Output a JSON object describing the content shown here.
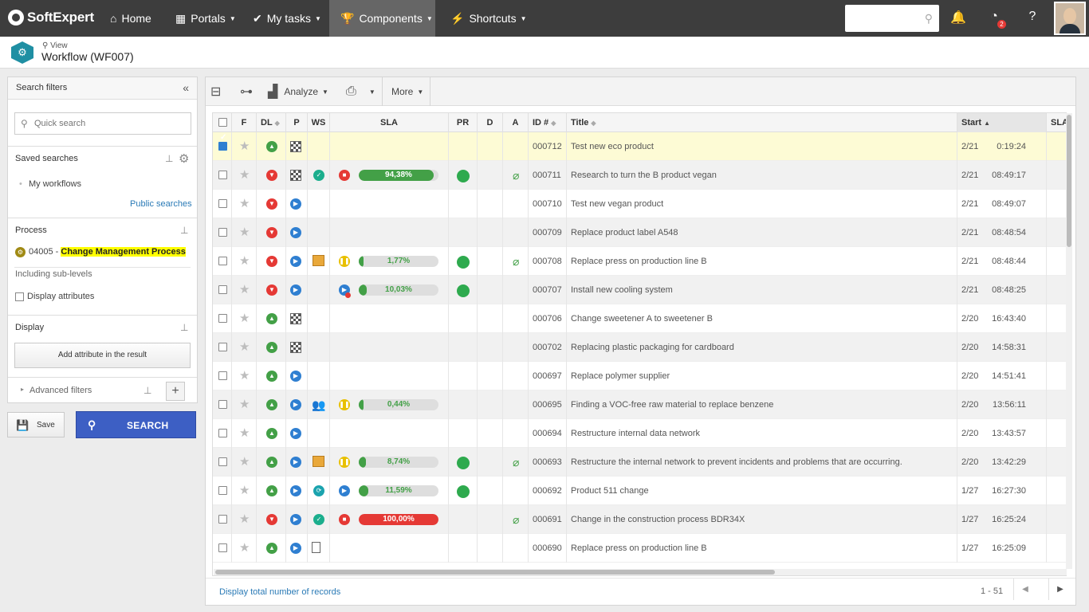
{
  "topnav": {
    "brand": "SoftExpert",
    "items": [
      {
        "label": "Home",
        "icon": "home-icon"
      },
      {
        "label": "Portals",
        "icon": "grid-icon"
      },
      {
        "label": "My tasks",
        "icon": "check-icon"
      },
      {
        "label": "Components",
        "icon": "trophy-icon"
      },
      {
        "label": "Shortcuts",
        "icon": "bolt-icon"
      }
    ],
    "search_placeholder": "",
    "notification_badge": "2"
  },
  "header": {
    "view_label": "View",
    "title": "Workflow (WF007)"
  },
  "leftpanel": {
    "title": "Search filters",
    "quick_search_placeholder": "Quick search",
    "saved_searches_label": "Saved searches",
    "my_workflows": "My workflows",
    "public_searches": "Public searches",
    "process_label": "Process",
    "process_code": "04005 - ",
    "process_name": "Change Management Process",
    "including_sublevels": "Including sub-levels",
    "display_attributes": "Display attributes",
    "display_label": "Display",
    "add_attribute": "Add attribute in the result",
    "advanced_filters": "Advanced filters",
    "save_label": "Save",
    "search_label": "SEARCH"
  },
  "toolbar": {
    "analyze_label": "Analyze",
    "more_label": "More"
  },
  "grid": {
    "columns": [
      "F",
      "DL",
      "P",
      "WS",
      "SLA",
      "PR",
      "D",
      "A",
      "ID #",
      "Title",
      "Start",
      "SLA"
    ],
    "rows": [
      {
        "id": "000712",
        "title": "Test new eco product",
        "date": "2/21",
        "time": "0:19:24",
        "dl": "up",
        "p": "flag",
        "ws": "",
        "sla_icon": "",
        "sla_pct": "",
        "sla_val": 0,
        "pr": false,
        "a": false,
        "checked": true
      },
      {
        "id": "000711",
        "title": "Research to turn the B product vegan",
        "date": "2/21",
        "time": "08:49:17",
        "dl": "down",
        "p": "flag",
        "ws": "ok",
        "sla_icon": "stop",
        "sla_pct": "94,38%",
        "sla_val": 94.38,
        "pr": true,
        "a": true,
        "checked": false
      },
      {
        "id": "000710",
        "title": "Test new vegan product",
        "date": "2/21",
        "time": "08:49:07",
        "dl": "down",
        "p": "play",
        "ws": "",
        "sla_icon": "",
        "sla_pct": "",
        "sla_val": 0,
        "pr": false,
        "a": false,
        "checked": false
      },
      {
        "id": "000709",
        "title": "Replace product label A548",
        "date": "2/21",
        "time": "08:48:54",
        "dl": "down",
        "p": "play",
        "ws": "",
        "sla_icon": "",
        "sla_pct": "",
        "sla_val": 0,
        "pr": false,
        "a": false,
        "checked": false
      },
      {
        "id": "000708",
        "title": "Replace press on production line B",
        "date": "2/21",
        "time": "08:48:44",
        "dl": "down",
        "p": "play",
        "ws": "box",
        "sla_icon": "pause",
        "sla_pct": "1,77%",
        "sla_val": 1.77,
        "pr": true,
        "a": true,
        "checked": false
      },
      {
        "id": "000707",
        "title": "Install new cooling system",
        "date": "2/21",
        "time": "08:48:25",
        "dl": "down",
        "p": "play",
        "ws": "",
        "sla_icon": "play-badge",
        "sla_pct": "10,03%",
        "sla_val": 10.03,
        "pr": true,
        "a": false,
        "checked": false
      },
      {
        "id": "000706",
        "title": "Change sweetener A to sweetener B",
        "date": "2/20",
        "time": "16:43:40",
        "dl": "up",
        "p": "flag",
        "ws": "",
        "sla_icon": "",
        "sla_pct": "",
        "sla_val": 0,
        "pr": false,
        "a": false,
        "checked": false
      },
      {
        "id": "000702",
        "title": "Replacing plastic packaging for cardboard",
        "date": "2/20",
        "time": "14:58:31",
        "dl": "up",
        "p": "flag",
        "ws": "",
        "sla_icon": "",
        "sla_pct": "",
        "sla_val": 0,
        "pr": false,
        "a": false,
        "checked": false
      },
      {
        "id": "000697",
        "title": "Replace polymer supplier",
        "date": "2/20",
        "time": "14:51:41",
        "dl": "up",
        "p": "play",
        "ws": "",
        "sla_icon": "",
        "sla_pct": "",
        "sla_val": 0,
        "pr": false,
        "a": false,
        "checked": false
      },
      {
        "id": "000695",
        "title": "Finding a VOC-free raw material to replace benzene",
        "date": "2/20",
        "time": "13:56:11",
        "dl": "up",
        "p": "play",
        "ws": "people",
        "sla_icon": "pause",
        "sla_pct": "0,44%",
        "sla_val": 0.44,
        "pr": false,
        "a": false,
        "checked": false
      },
      {
        "id": "000694",
        "title": "Restructure internal data network",
        "date": "2/20",
        "time": "13:43:57",
        "dl": "up",
        "p": "play",
        "ws": "",
        "sla_icon": "",
        "sla_pct": "",
        "sla_val": 0,
        "pr": false,
        "a": false,
        "checked": false
      },
      {
        "id": "000693",
        "title": "Restructure the internal network to prevent incidents and problems that are occurring.",
        "date": "2/20",
        "time": "13:42:29",
        "dl": "up",
        "p": "play",
        "ws": "box",
        "sla_icon": "pause",
        "sla_pct": "8,74%",
        "sla_val": 8.74,
        "pr": true,
        "a": true,
        "checked": false
      },
      {
        "id": "000692",
        "title": "Product 511 change",
        "date": "1/27",
        "time": "16:27:30",
        "dl": "up",
        "p": "play",
        "ws": "sync",
        "sla_icon": "play",
        "sla_pct": "11,59%",
        "sla_val": 11.59,
        "pr": true,
        "a": false,
        "checked": false
      },
      {
        "id": "000691",
        "title": "Change in the construction process BDR34X",
        "date": "1/27",
        "time": "16:25:24",
        "dl": "down",
        "p": "play",
        "ws": "ok",
        "sla_icon": "stop",
        "sla_pct": "100,00%",
        "sla_val": 100,
        "pr": false,
        "a": true,
        "checked": false
      },
      {
        "id": "000690",
        "title": "Replace press on production line B",
        "date": "1/27",
        "time": "16:25:09",
        "dl": "up",
        "p": "play",
        "ws": "clipboard",
        "sla_icon": "",
        "sla_pct": "",
        "sla_val": 0,
        "pr": false,
        "a": false,
        "checked": false
      }
    ]
  },
  "footer": {
    "display_total": "Display total number of records",
    "range": "1 - 51"
  },
  "colors": {
    "nav_bg": "#3d3d3d",
    "accent": "#3d5fc4",
    "green": "#43a047",
    "red": "#e53935"
  }
}
